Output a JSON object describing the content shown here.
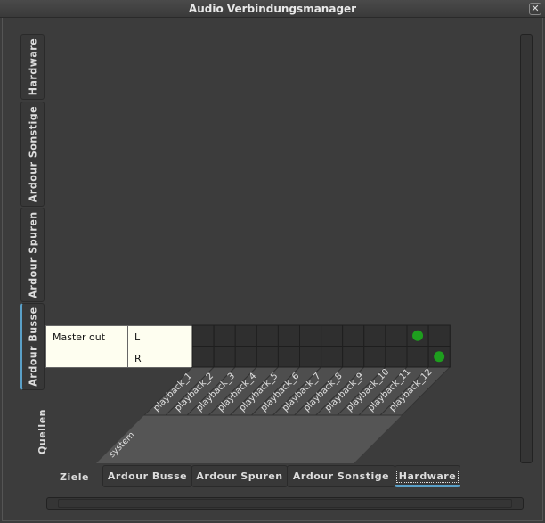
{
  "window": {
    "title": "Audio Verbindungsmanager"
  },
  "sources": {
    "label": "Quellen",
    "tabs": [
      {
        "label": "Hardware"
      },
      {
        "label": "Ardour Sonstige"
      },
      {
        "label": "Ardour Spuren"
      },
      {
        "label": "Ardour Busse",
        "active": true
      }
    ]
  },
  "destinations": {
    "label": "Ziele",
    "tabs": [
      {
        "label": "Ardour Busse"
      },
      {
        "label": "Ardour Spuren"
      },
      {
        "label": "Ardour Sonstige"
      },
      {
        "label": "Hardware",
        "active": true
      }
    ]
  },
  "matrix": {
    "bundle": "Master out",
    "channels": [
      "L",
      "R"
    ],
    "dest_group": "system",
    "ports": [
      "playback_1",
      "playback_2",
      "playback_3",
      "playback_4",
      "playback_5",
      "playback_6",
      "playback_7",
      "playback_8",
      "playback_9",
      "playback_10",
      "playback_11",
      "playback_12"
    ],
    "connections": [
      [
        0,
        10
      ],
      [
        1,
        11
      ]
    ],
    "dot_color": "#1e9e1e"
  }
}
